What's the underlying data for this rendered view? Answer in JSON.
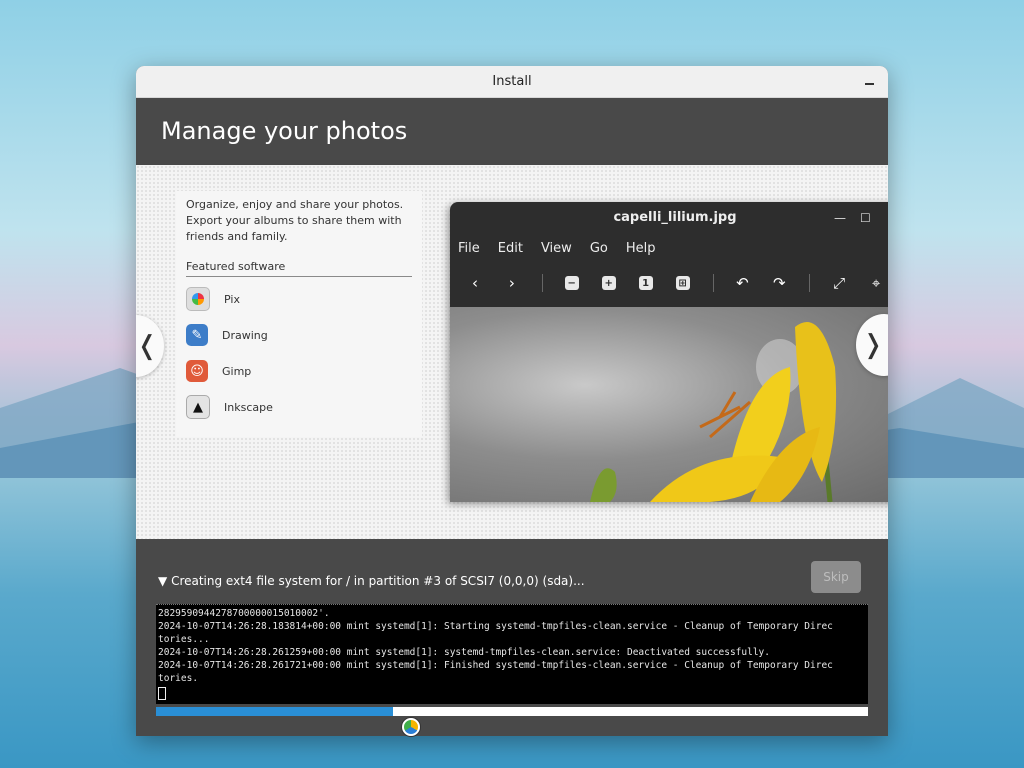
{
  "window": {
    "title": "Install"
  },
  "header": {
    "title": "Manage your photos"
  },
  "slide": {
    "description": "Organize, enjoy and share your photos. Export your albums to share them with friends and family.",
    "featured_label": "Featured software",
    "apps": [
      {
        "name": "Pix",
        "icon": "pix-icon"
      },
      {
        "name": "Drawing",
        "icon": "drawing-icon"
      },
      {
        "name": "Gimp",
        "icon": "gimp-icon"
      },
      {
        "name": "Inkscape",
        "icon": "inkscape-icon"
      }
    ],
    "viewer": {
      "title": "capelli_lilium.jpg",
      "menu": [
        "File",
        "Edit",
        "View",
        "Go",
        "Help"
      ],
      "toolbar_zoom_label": "1"
    },
    "prev_glyph": "❬",
    "next_glyph": "❭"
  },
  "progress": {
    "status": "Creating ext4 file system for / in partition #3 of SCSI7 (0,0,0) (sda)...",
    "skip_label": "Skip",
    "fraction": 0.333,
    "terminal_lines": [
      "2829590944278700000015010002'.",
      "2024-10-07T14:26:28.183814+00:00 mint systemd[1]: Starting systemd-tmpfiles-clean.service - Cleanup of Temporary Direc",
      "tories...",
      "2024-10-07T14:26:28.261259+00:00 mint systemd[1]: systemd-tmpfiles-clean.service: Deactivated successfully.",
      "2024-10-07T14:26:28.261721+00:00 mint systemd[1]: Finished systemd-tmpfiles-clean.service - Cleanup of Temporary Direc",
      "tories."
    ]
  },
  "colors": {
    "accent": "#2a8fd6",
    "header_bg": "#494949"
  }
}
